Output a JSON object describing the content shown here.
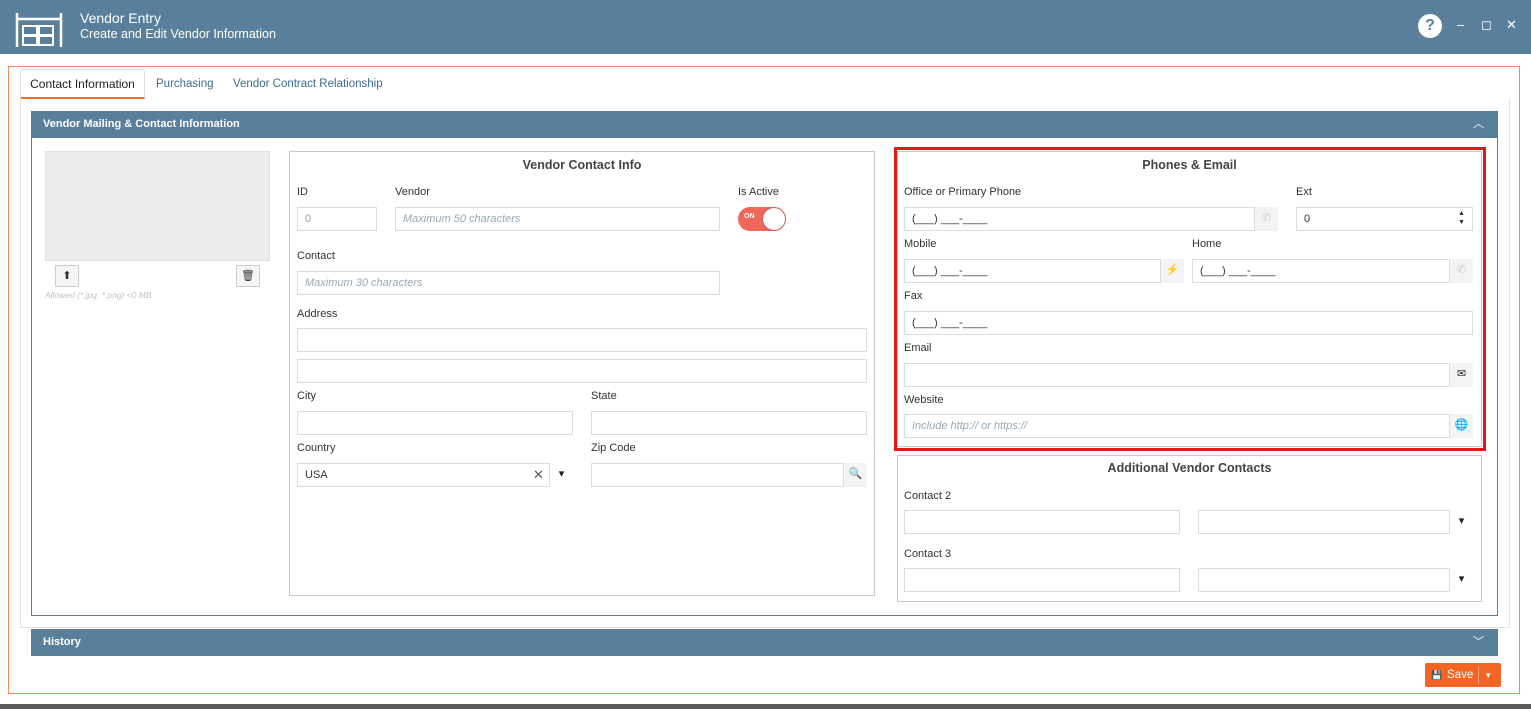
{
  "window": {
    "title": "Vendor Entry",
    "subtitle": "Create and Edit Vendor Information",
    "help": "?",
    "minimize": "–",
    "maximize": "◻",
    "close": "✕"
  },
  "tabs": [
    {
      "label": "Contact Information",
      "active": true
    },
    {
      "label": "Purchasing",
      "active": false
    },
    {
      "label": "Vendor Contract Relationship",
      "active": false
    }
  ],
  "sections": {
    "mailing": {
      "title": "Vendor Mailing & Contact Information",
      "chevron": "︿"
    },
    "history": {
      "title": "History",
      "chevron": "﹀"
    }
  },
  "image": {
    "upload_icon": "⬆",
    "delete_icon": "🗑",
    "note": "Allowed (*.jpg, *.png) <0 MB"
  },
  "vendor_contact": {
    "title": "Vendor Contact Info",
    "id_label": "ID",
    "id_value": "0",
    "vendor_label": "Vendor",
    "vendor_placeholder": "Maximum 50 characters",
    "active_label": "Is Active",
    "active_state": "ON",
    "contact_label": "Contact",
    "contact_placeholder": "Maximum 30 characters",
    "address_label": "Address",
    "city_label": "City",
    "state_label": "State",
    "country_label": "Country",
    "country_value": "USA",
    "clear_icon": "✕",
    "dropdown_icon": "▾",
    "zip_label": "Zip Code",
    "search_icon": "🔍"
  },
  "phones_email": {
    "title": "Phones & Email",
    "office_label": "Office or Primary Phone",
    "office_value": "(___) ___-____",
    "ext_label": "Ext",
    "ext_value": "0",
    "mobile_label": "Mobile",
    "mobile_value": "(___) ___-____",
    "home_label": "Home",
    "home_value": "(___) ___-____",
    "fax_label": "Fax",
    "fax_value": "(___) ___-____",
    "email_label": "Email",
    "website_label": "Website",
    "website_placeholder": "Include http:// or https://",
    "phone_icon": "✆",
    "rss_icon": "⚡",
    "mail_icon": "✉",
    "globe_icon": "🌐",
    "spin_up": "▲",
    "spin_down": "▼"
  },
  "additional": {
    "title": "Additional Vendor Contacts",
    "contact2_label": "Contact 2",
    "contact3_label": "Contact 3",
    "dropdown_icon": "▾"
  },
  "footer": {
    "save_label": "Save",
    "save_icon": "💾",
    "dropdown_icon": "▾"
  },
  "colors": {
    "header": "#5a7f9b",
    "accent": "#f26522",
    "highlight": "#e01818"
  }
}
